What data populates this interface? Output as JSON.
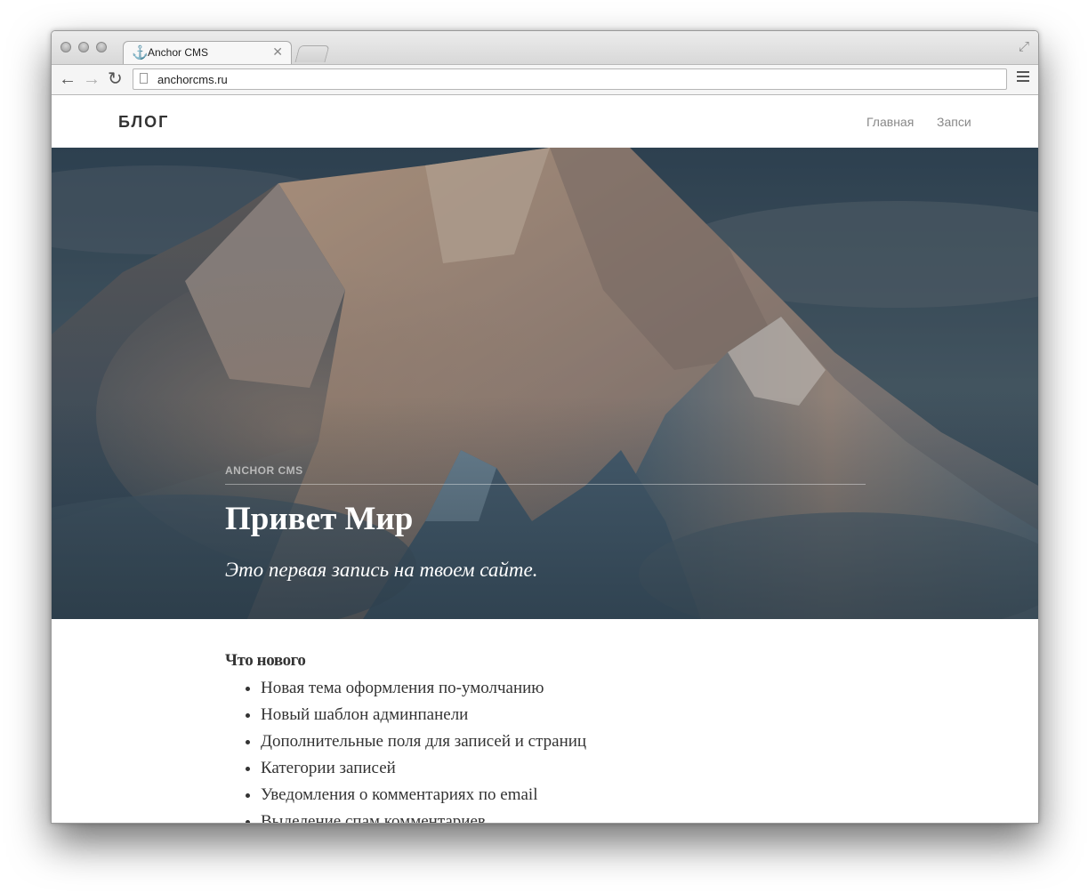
{
  "browser": {
    "tab_title": "Anchor CMS",
    "tab_icon": "anchor-icon",
    "url": "anchorcms.ru",
    "icons": {
      "back": "back-arrow-icon",
      "forward": "forward-arrow-icon",
      "reload": "reload-icon",
      "menu": "hamburger-menu-icon",
      "fullscreen": "fullscreen-icon",
      "close": "close-icon",
      "page": "page-icon"
    }
  },
  "site": {
    "logo": "БЛОГ",
    "nav": [
      "Главная",
      "Запси"
    ]
  },
  "hero": {
    "category": "ANCHOR CMS",
    "title": "Привет Мир",
    "subtitle": "Это первая запись на твоем сайте.",
    "image": "snowy-mountain-peaks-sunrise"
  },
  "content": {
    "heading": "Что нового",
    "items": [
      "Новая тема оформления по-умолчанию",
      "Новый шаблон админпанели",
      "Дополнительные поля для записей и страниц",
      "Категории записей",
      "Уведомления о комментариях по email",
      "Выделение спам комментариев"
    ]
  },
  "colors": {
    "hero_overlay": "#2f4555",
    "mountain_light": "#c79a7a",
    "logo": "#333333",
    "nav": "#888888"
  }
}
